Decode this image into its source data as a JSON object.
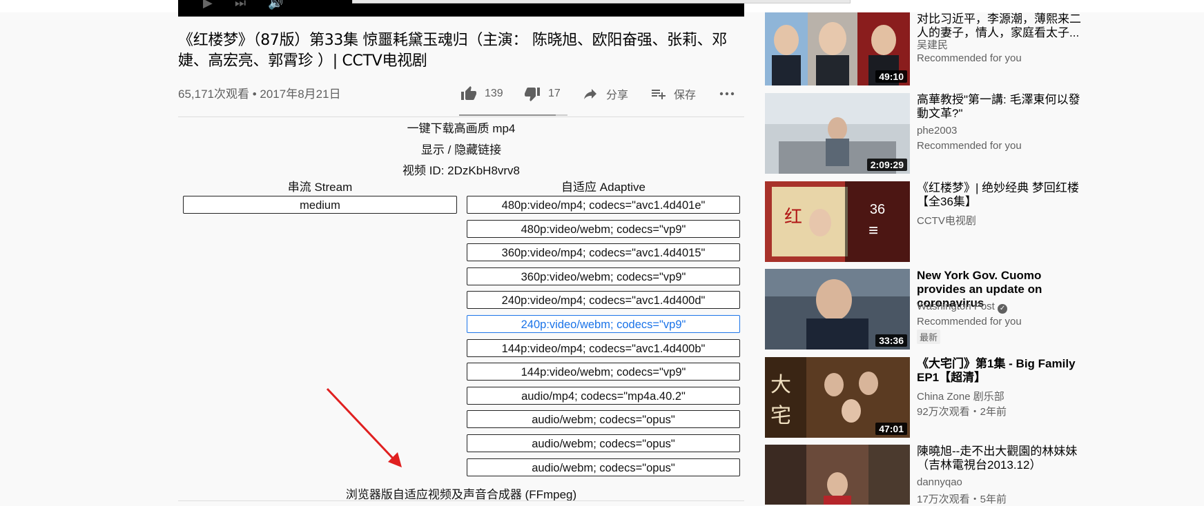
{
  "video": {
    "title": "《红楼梦》（87版）第33集 惊噩耗黛玉魂归（主演： 陈晓旭、欧阳奋强、张莉、邓婕、高宏亮、郭霄珍 ）| CCTV电视剧",
    "views_date": "65,171次观看 • 2017年8月21日",
    "likes": "139",
    "dislikes": "17",
    "share_label": "分享",
    "save_label": "保存",
    "like_ratio": 0.89
  },
  "downloader": {
    "download_link": "一键下载高画质 mp4",
    "toggle_link": "显示 / 隐藏链接",
    "video_id": "视频 ID: 2DzKbH8vrv8",
    "stream_title": "串流 Stream",
    "adaptive_title": "自适应 Adaptive",
    "stream_items": [
      "medium"
    ],
    "adaptive_items": [
      "480p:video/mp4; codecs=\"avc1.4d401e\"",
      "480p:video/webm; codecs=\"vp9\"",
      "360p:video/mp4; codecs=\"avc1.4d4015\"",
      "360p:video/webm; codecs=\"vp9\"",
      "240p:video/mp4; codecs=\"avc1.4d400d\"",
      "240p:video/webm; codecs=\"vp9\"",
      "144p:video/mp4; codecs=\"avc1.4d400b\"",
      "144p:video/webm; codecs=\"vp9\"",
      "audio/mp4; codecs=\"mp4a.40.2\"",
      "audio/webm; codecs=\"opus\"",
      "audio/webm; codecs=\"opus\"",
      "audio/webm; codecs=\"opus\""
    ],
    "selected_index": 5,
    "ffmpeg_label": "浏览器版自适应视频及声音合成器 (FFmpeg)"
  },
  "sidebar": {
    "items": [
      {
        "title": "对比习近平，李源潮，薄熙来二人的妻子，情人，家庭看太子...",
        "channel": "吴建民",
        "meta": "Recommended for you",
        "duration": "49:10"
      },
      {
        "title": "高華教授\"第一講: 毛澤東何以發動文革?\"",
        "channel": "phe2003",
        "meta": "Recommended for you",
        "duration": "2:09:29"
      },
      {
        "title": "《红楼梦》| 绝妙经典 梦回红楼【全36集】",
        "channel": "CCTV电视剧",
        "playlist_count": "36"
      },
      {
        "title": "New York Gov. Cuomo provides an update on coronavirus",
        "channel": "Washington Post",
        "meta": "Recommended for you",
        "badge": "最新",
        "duration": "33:36"
      },
      {
        "title": "《大宅门》第1集 - Big Family EP1【超清】",
        "channel": "China Zone 剧乐部",
        "meta": "92万次观看・2年前",
        "duration": "47:01"
      },
      {
        "title": "陳曉旭--走不出大觀園的林妹妹（吉林電視台2013.12）",
        "channel": "dannyqao",
        "meta": "17万次观看・5年前"
      }
    ]
  },
  "colors": {
    "selected_link": "#1a73e8",
    "arrow": "#e02020",
    "text_secondary": "#606060"
  }
}
